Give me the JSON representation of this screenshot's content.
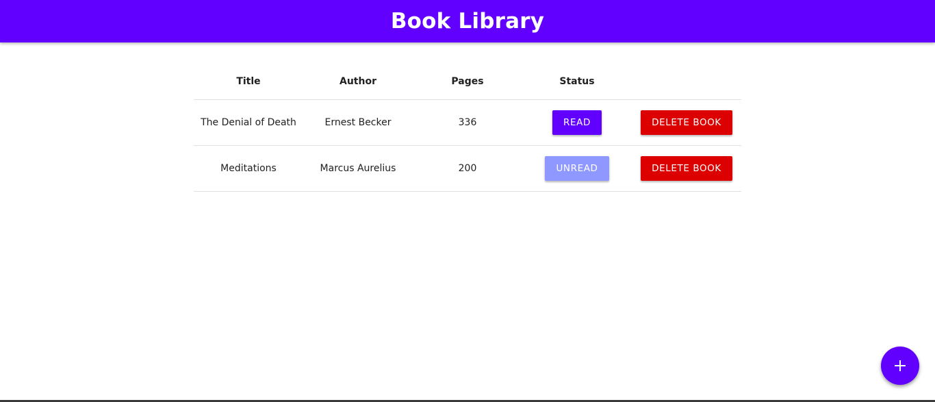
{
  "header": {
    "title": "Book Library"
  },
  "table": {
    "columns": [
      "Title",
      "Author",
      "Pages",
      "Status",
      ""
    ],
    "rows": [
      {
        "title": "The Denial of Death",
        "author": "Ernest Becker",
        "pages": "336",
        "status": "READ",
        "action": "DELETE BOOK"
      },
      {
        "title": "Meditations",
        "author": "Marcus Aurelius",
        "pages": "200",
        "status": "UNREAD",
        "action": "DELETE BOOK"
      }
    ]
  },
  "fab": {
    "icon": "plus-icon"
  },
  "colors": {
    "primary": "#6200ff",
    "unread": "#8f98ff",
    "delete": "#dd0000"
  }
}
